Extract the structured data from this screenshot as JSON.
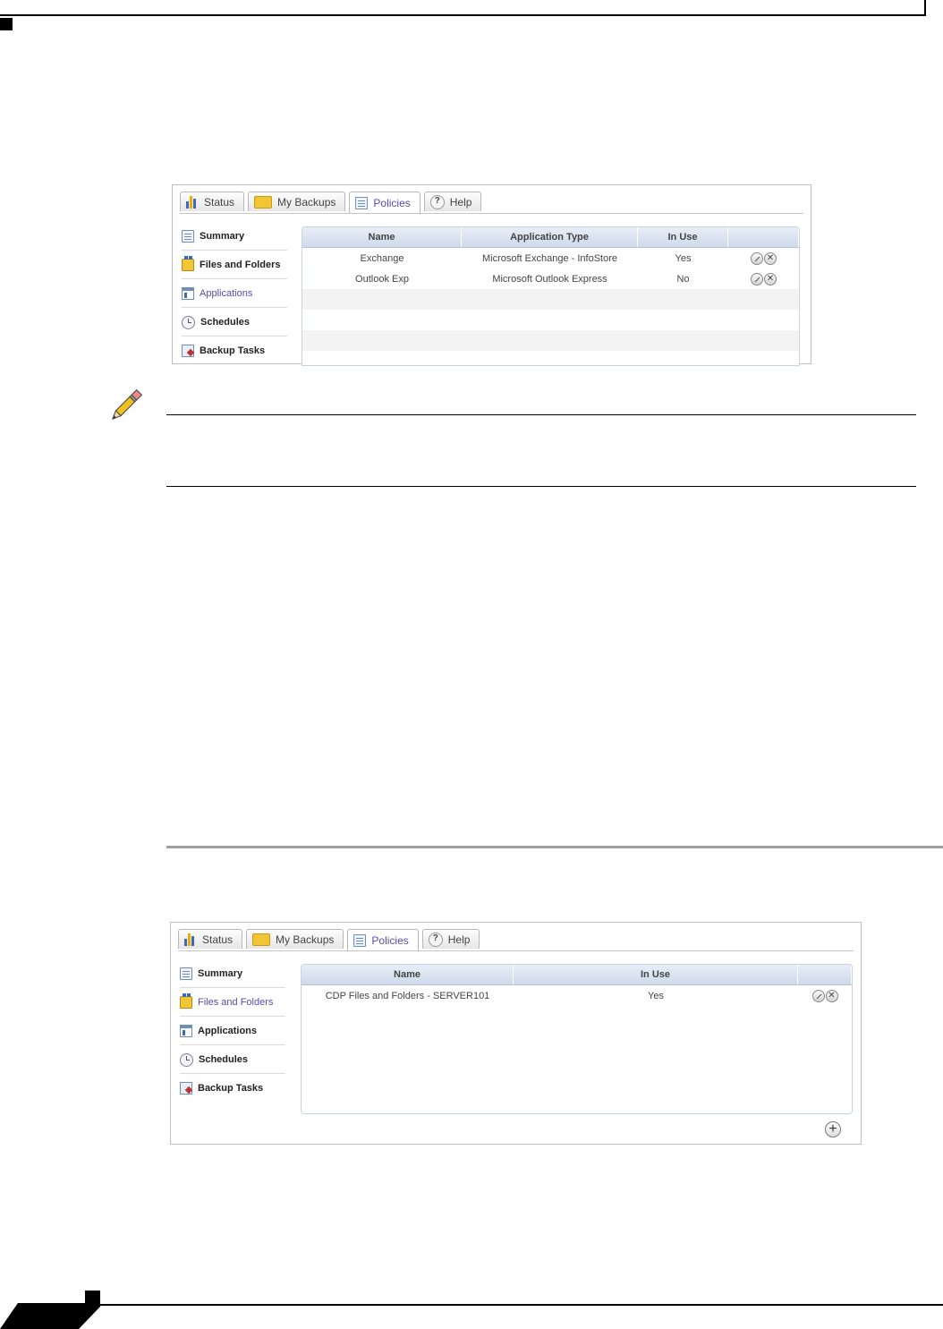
{
  "colors": {
    "accent": "#5a4ab0",
    "grid_header": "#cfd9ea",
    "section_rule": "#a0a0a0"
  },
  "shot1": {
    "tabs": [
      {
        "label": "Status",
        "icon": "bar-chart-icon"
      },
      {
        "label": "My Backups",
        "icon": "folder-icon"
      },
      {
        "label": "Policies",
        "icon": "document-icon",
        "active": true
      },
      {
        "label": "Help",
        "icon": "help-icon"
      }
    ],
    "sidebar": [
      {
        "label": "Summary",
        "icon": "summary-icon"
      },
      {
        "label": "Files and Folders",
        "icon": "files-icon"
      },
      {
        "label": "Applications",
        "icon": "applications-icon",
        "active": true
      },
      {
        "label": "Schedules",
        "icon": "clock-icon"
      },
      {
        "label": "Backup Tasks",
        "icon": "backup-tasks-icon"
      }
    ],
    "columns": [
      "Name",
      "Application Type",
      "In Use",
      ""
    ],
    "rows": [
      {
        "name": "Exchange",
        "type": "Microsoft Exchange - InfoStore",
        "in_use": "Yes"
      },
      {
        "name": "Outlook Exp",
        "type": "Microsoft Outlook Express",
        "in_use": "No"
      }
    ]
  },
  "shot2": {
    "tabs": [
      {
        "label": "Status",
        "icon": "bar-chart-icon"
      },
      {
        "label": "My Backups",
        "icon": "folder-icon"
      },
      {
        "label": "Policies",
        "icon": "document-icon",
        "active": true
      },
      {
        "label": "Help",
        "icon": "help-icon"
      }
    ],
    "sidebar": [
      {
        "label": "Summary",
        "icon": "summary-icon"
      },
      {
        "label": "Files and Folders",
        "icon": "files-icon",
        "active": true
      },
      {
        "label": "Applications",
        "icon": "applications-icon"
      },
      {
        "label": "Schedules",
        "icon": "clock-icon"
      },
      {
        "label": "Backup Tasks",
        "icon": "backup-tasks-icon"
      }
    ],
    "columns": [
      "Name",
      "In Use",
      ""
    ],
    "rows": [
      {
        "name": "CDP Files and Folders - SERVER101",
        "in_use": "Yes"
      }
    ]
  }
}
